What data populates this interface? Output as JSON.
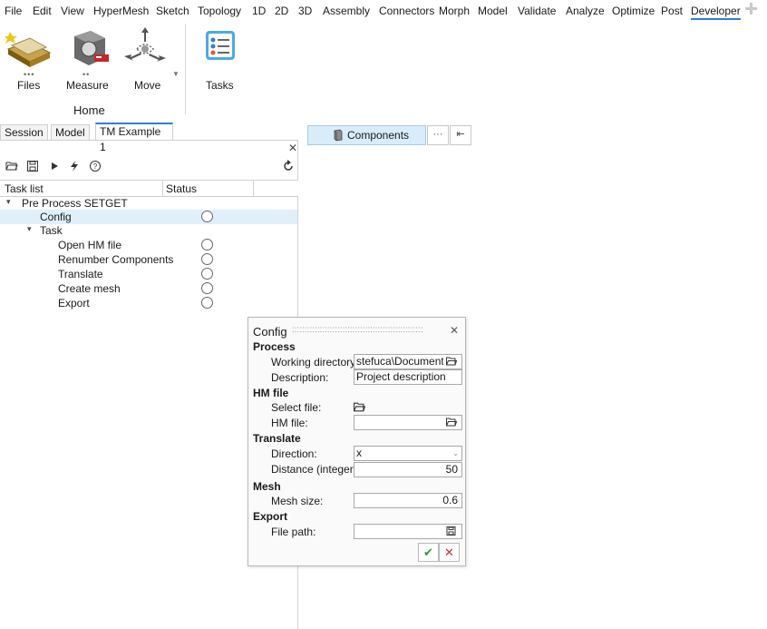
{
  "menu": [
    "File",
    "Edit",
    "View",
    "HyperMesh",
    "Sketch",
    "Topology",
    "1D",
    "2D",
    "3D",
    "Assembly",
    "Connectors",
    "Morph",
    "Model",
    "Validate",
    "Analyze",
    "Optimize",
    "Post",
    "Developer"
  ],
  "ribbon": {
    "files_label": "Files",
    "measure_label": "Measure",
    "move_label": "Move",
    "tasks_label": "Tasks",
    "group_label": "Home"
  },
  "tabs": [
    "Session",
    "Model",
    "TM Example 1"
  ],
  "panel": {
    "col_task": "Task list",
    "col_status": "Status"
  },
  "tree": {
    "root": "Pre Process SETGET",
    "config": "Config",
    "task": "Task",
    "open_hm": "Open HM file",
    "renumber": "Renumber Components",
    "translate": "Translate",
    "create_mesh": "Create mesh",
    "export": "Export"
  },
  "components": {
    "label": "Components",
    "more": "···"
  },
  "dialog": {
    "title": "Config",
    "process": "Process",
    "working_dir_label": "Working directory:",
    "working_dir_value": "stefuca\\Documents",
    "description_label": "Description:",
    "description_value": "Project description",
    "hmfile": "HM file",
    "select_file_label": "Select file:",
    "hm_file_label": "HM file:",
    "hm_file_value": "",
    "translate": "Translate",
    "direction_label": "Direction:",
    "direction_value": "x",
    "distance_label": "Distance (integer):",
    "distance_value": "50",
    "mesh": "Mesh",
    "mesh_size_label": "Mesh size:",
    "mesh_size_value": "0.6",
    "export": "Export",
    "file_path_label": "File path:",
    "file_path_value": ""
  },
  "colors": {
    "accent": "#2f7ed8",
    "selected_row": "#e0f0fb",
    "components_bg": "#d8ecfa",
    "ok": "#2e9a2e",
    "cancel": "#d42a2a"
  }
}
